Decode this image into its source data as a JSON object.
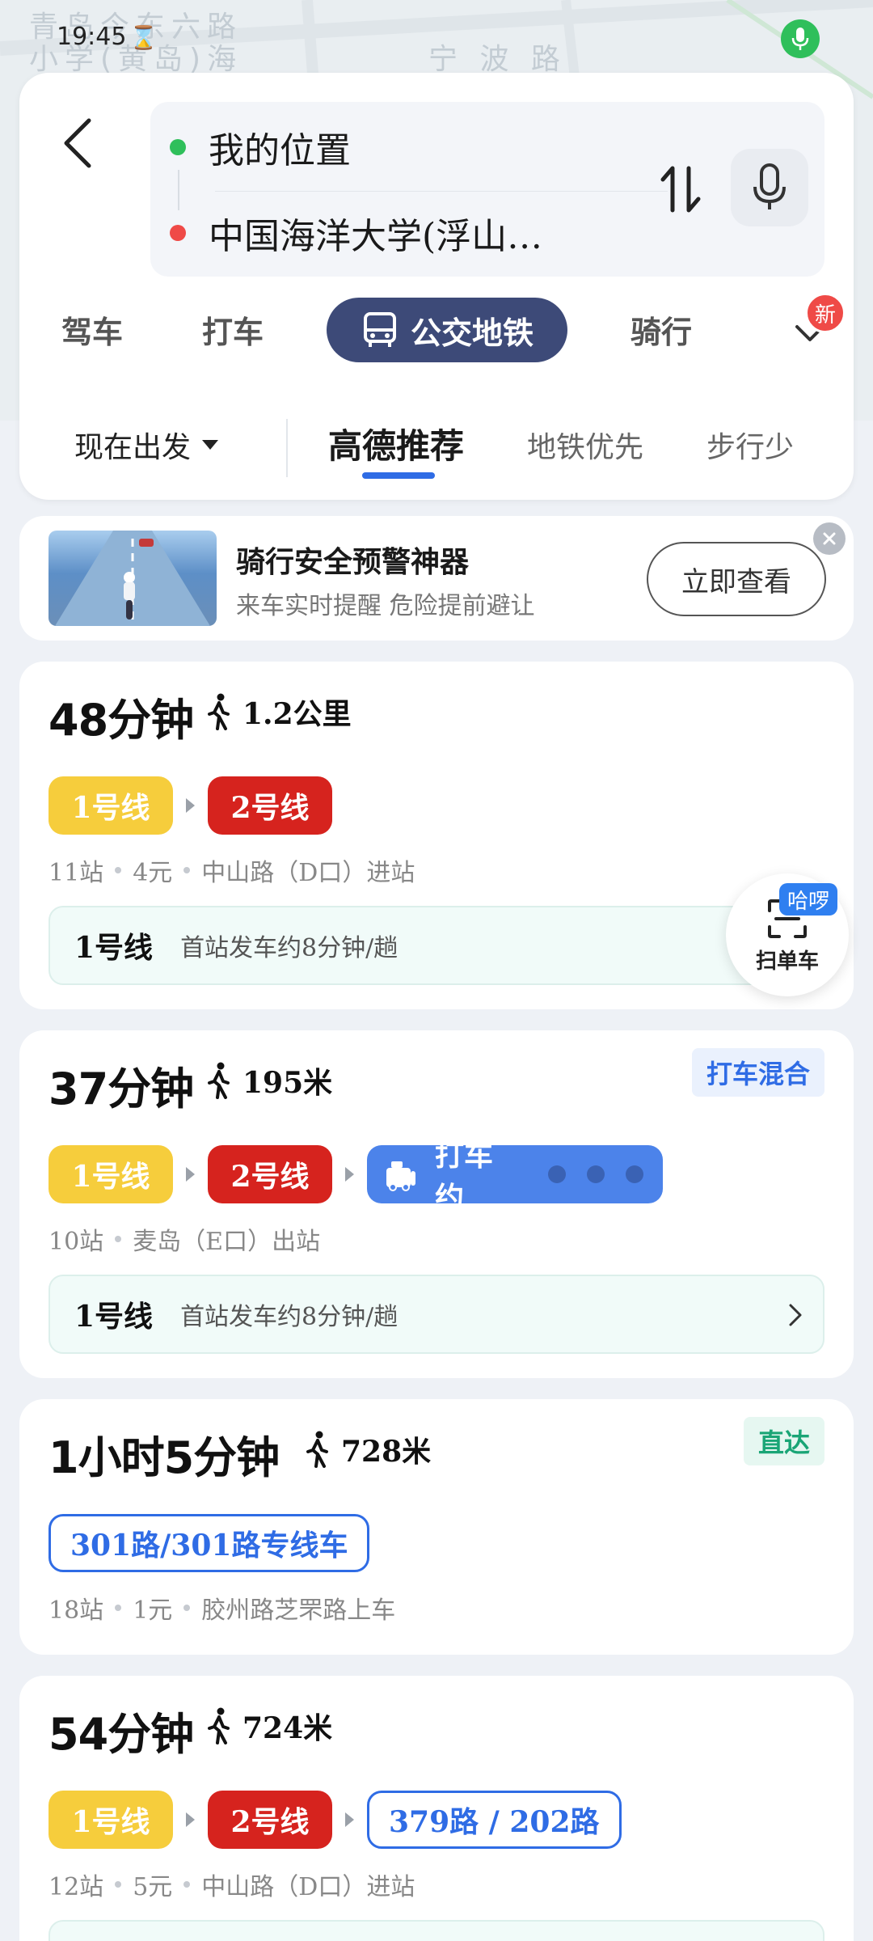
{
  "status_bar": {
    "time": "19:45"
  },
  "map": {
    "labels": [
      "青岛今东六路",
      "小学(黄岛)海",
      "宁 波 路"
    ]
  },
  "search": {
    "start": "我的位置",
    "end": "中国海洋大学(浮山…",
    "start_color": "#2fbf5b",
    "end_color": "#ef4a47"
  },
  "modes": {
    "items": [
      "驾车",
      "打车",
      "公交地铁",
      "骑行"
    ],
    "active": "公交地铁",
    "new_badge": "新"
  },
  "filters": {
    "depart": "现在出发",
    "tabs": [
      "高德推荐",
      "地铁优先",
      "步行少"
    ],
    "active": "高德推荐"
  },
  "ad": {
    "title": "骑行安全预警神器",
    "subtitle": "来车实时提醒 危险提前避让",
    "button": "立即查看"
  },
  "routes": [
    {
      "duration": "48分钟",
      "walk": "1.2公里",
      "segments": [
        "1号线",
        "2号线"
      ],
      "info": [
        "11站",
        "4元",
        "中山路（D口）进站"
      ],
      "detail_line": "1号线",
      "detail_desc": "首站发车约8分钟/趟"
    },
    {
      "duration": "37分钟",
      "walk": "195米",
      "tag": "打车混合",
      "segments": [
        "1号线",
        "2号线",
        "打车 约"
      ],
      "info": [
        "10站",
        "麦岛（E口）出站"
      ],
      "detail_line": "1号线",
      "detail_desc": "首站发车约8分钟/趟"
    },
    {
      "duration": "1小时5分钟",
      "walk": "728米",
      "tag": "直达",
      "segments": [
        "301路/301路专线车"
      ],
      "info": [
        "18站",
        "1元",
        "胶州路芝罘路上车"
      ]
    },
    {
      "duration": "54分钟",
      "walk": "724米",
      "segments": [
        "1号线",
        "2号线",
        "379路 / 202路"
      ],
      "info": [
        "12站",
        "5元",
        "中山路（D口）进站"
      ]
    }
  ],
  "scan_float": {
    "label": "扫单车",
    "badge": "哈啰"
  },
  "colors": {
    "accent_blue": "#2f6ce5",
    "line1_yellow": "#f6cd3c",
    "line2_red": "#d6231e",
    "active_mode_bg": "#3d4a78",
    "taxi_blue": "#4c83ea",
    "tag_taxi_bg": "#eaf1fd",
    "tag_direct_bg": "#e6f7f1"
  }
}
